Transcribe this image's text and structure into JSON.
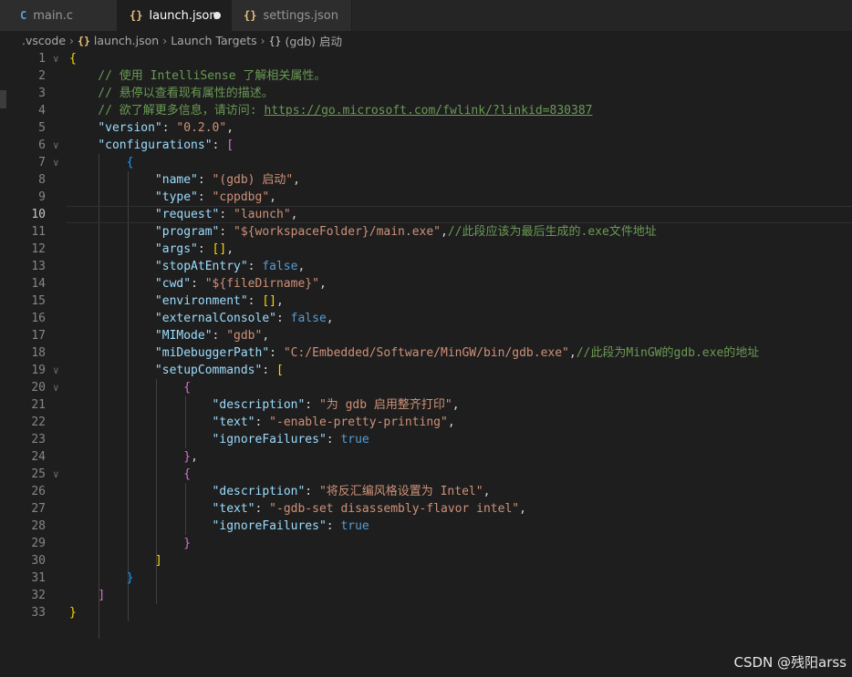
{
  "tabs": [
    {
      "label": "main.c",
      "icon": "C"
    },
    {
      "label": "launch.json",
      "icon": "{}"
    },
    {
      "label": "settings.json",
      "icon": "{}"
    }
  ],
  "breadcrumb": {
    "folder": ".vscode",
    "file": "launch.json",
    "section": "Launch Targets",
    "item": "(gdb) 启动"
  },
  "editor": {
    "active_line": 10,
    "lines": [
      {
        "n": "1",
        "fold": "v",
        "tok": [
          [
            "{",
            "y"
          ]
        ]
      },
      {
        "n": "2",
        "tok": [
          [
            "    // 使用 IntelliSense 了解相关属性。",
            "c"
          ]
        ]
      },
      {
        "n": "3",
        "tok": [
          [
            "    // 悬停以查看现有属性的描述。",
            "c"
          ]
        ]
      },
      {
        "n": "4",
        "tok": [
          [
            "    // 欲了解更多信息，请访问: ",
            "c"
          ],
          [
            "https://go.microsoft.com/fwlink/?linkid=830387",
            "cu"
          ]
        ]
      },
      {
        "n": "5",
        "tok": [
          [
            "    ",
            "p"
          ],
          [
            "\"version\"",
            "k"
          ],
          [
            ": ",
            "p"
          ],
          [
            "\"0.2.0\"",
            "s"
          ],
          [
            ",",
            "p"
          ]
        ]
      },
      {
        "n": "6",
        "fold": "v",
        "tok": [
          [
            "    ",
            "p"
          ],
          [
            "\"configurations\"",
            "k"
          ],
          [
            ": ",
            "p"
          ],
          [
            "[",
            "m"
          ]
        ]
      },
      {
        "n": "7",
        "fold": "v",
        "tok": [
          [
            "        ",
            "p"
          ],
          [
            "{",
            "bl"
          ]
        ]
      },
      {
        "n": "8",
        "tok": [
          [
            "            ",
            "p"
          ],
          [
            "\"name\"",
            "k"
          ],
          [
            ": ",
            "p"
          ],
          [
            "\"(gdb) 启动\"",
            "s"
          ],
          [
            ",",
            "p"
          ]
        ]
      },
      {
        "n": "9",
        "tok": [
          [
            "            ",
            "p"
          ],
          [
            "\"type\"",
            "k"
          ],
          [
            ": ",
            "p"
          ],
          [
            "\"cppdbg\"",
            "s"
          ],
          [
            ",",
            "p"
          ]
        ]
      },
      {
        "n": "10",
        "tok": [
          [
            "            ",
            "p"
          ],
          [
            "\"request\"",
            "k"
          ],
          [
            ": ",
            "p"
          ],
          [
            "\"launch\"",
            "s"
          ],
          [
            ",",
            "p"
          ]
        ]
      },
      {
        "n": "11",
        "tok": [
          [
            "            ",
            "p"
          ],
          [
            "\"program\"",
            "k"
          ],
          [
            ": ",
            "p"
          ],
          [
            "\"${workspaceFolder}/main.exe\"",
            "s"
          ],
          [
            ",",
            "p"
          ],
          [
            "//此段应该为最后生成的.exe文件地址",
            "c"
          ]
        ]
      },
      {
        "n": "12",
        "tok": [
          [
            "            ",
            "p"
          ],
          [
            "\"args\"",
            "k"
          ],
          [
            ": ",
            "p"
          ],
          [
            "[]",
            "y"
          ],
          [
            ",",
            "p"
          ]
        ]
      },
      {
        "n": "13",
        "tok": [
          [
            "            ",
            "p"
          ],
          [
            "\"stopAtEntry\"",
            "k"
          ],
          [
            ": ",
            "p"
          ],
          [
            "false",
            "b"
          ],
          [
            ",",
            "p"
          ]
        ]
      },
      {
        "n": "14",
        "tok": [
          [
            "            ",
            "p"
          ],
          [
            "\"cwd\"",
            "k"
          ],
          [
            ": ",
            "p"
          ],
          [
            "\"${fileDirname}\"",
            "s"
          ],
          [
            ",",
            "p"
          ]
        ]
      },
      {
        "n": "15",
        "tok": [
          [
            "            ",
            "p"
          ],
          [
            "\"environment\"",
            "k"
          ],
          [
            ": ",
            "p"
          ],
          [
            "[]",
            "y"
          ],
          [
            ",",
            "p"
          ]
        ]
      },
      {
        "n": "16",
        "tok": [
          [
            "            ",
            "p"
          ],
          [
            "\"externalConsole\"",
            "k"
          ],
          [
            ": ",
            "p"
          ],
          [
            "false",
            "b"
          ],
          [
            ",",
            "p"
          ]
        ]
      },
      {
        "n": "17",
        "tok": [
          [
            "            ",
            "p"
          ],
          [
            "\"MIMode\"",
            "k"
          ],
          [
            ": ",
            "p"
          ],
          [
            "\"gdb\"",
            "s"
          ],
          [
            ",",
            "p"
          ]
        ]
      },
      {
        "n": "18",
        "tok": [
          [
            "            ",
            "p"
          ],
          [
            "\"miDebuggerPath\"",
            "k"
          ],
          [
            ": ",
            "p"
          ],
          [
            "\"C:/Embedded/Software/MinGW/bin/gdb.exe\"",
            "s"
          ],
          [
            ",",
            "p"
          ],
          [
            "//此段为MinGW的gdb.exe的地址",
            "c"
          ]
        ]
      },
      {
        "n": "19",
        "fold": "v",
        "tok": [
          [
            "            ",
            "p"
          ],
          [
            "\"setupCommands\"",
            "k"
          ],
          [
            ": ",
            "p"
          ],
          [
            "[",
            "y"
          ]
        ]
      },
      {
        "n": "20",
        "fold": "v",
        "tok": [
          [
            "                ",
            "p"
          ],
          [
            "{",
            "m"
          ]
        ]
      },
      {
        "n": "21",
        "tok": [
          [
            "                    ",
            "p"
          ],
          [
            "\"description\"",
            "k"
          ],
          [
            ": ",
            "p"
          ],
          [
            "\"为 gdb 启用整齐打印\"",
            "s"
          ],
          [
            ",",
            "p"
          ]
        ]
      },
      {
        "n": "22",
        "tok": [
          [
            "                    ",
            "p"
          ],
          [
            "\"text\"",
            "k"
          ],
          [
            ": ",
            "p"
          ],
          [
            "\"-enable-pretty-printing\"",
            "s"
          ],
          [
            ",",
            "p"
          ]
        ]
      },
      {
        "n": "23",
        "tok": [
          [
            "                    ",
            "p"
          ],
          [
            "\"ignoreFailures\"",
            "k"
          ],
          [
            ": ",
            "p"
          ],
          [
            "true",
            "b"
          ]
        ]
      },
      {
        "n": "24",
        "tok": [
          [
            "                ",
            "p"
          ],
          [
            "}",
            "m"
          ],
          [
            ",",
            "p"
          ]
        ]
      },
      {
        "n": "25",
        "fold": "v",
        "tok": [
          [
            "                ",
            "p"
          ],
          [
            "{",
            "m"
          ]
        ]
      },
      {
        "n": "26",
        "tok": [
          [
            "                    ",
            "p"
          ],
          [
            "\"description\"",
            "k"
          ],
          [
            ": ",
            "p"
          ],
          [
            "\"将反汇编风格设置为 Intel\"",
            "s"
          ],
          [
            ",",
            "p"
          ]
        ]
      },
      {
        "n": "27",
        "tok": [
          [
            "                    ",
            "p"
          ],
          [
            "\"text\"",
            "k"
          ],
          [
            ": ",
            "p"
          ],
          [
            "\"-gdb-set disassembly-flavor intel\"",
            "s"
          ],
          [
            ",",
            "p"
          ]
        ]
      },
      {
        "n": "28",
        "tok": [
          [
            "                    ",
            "p"
          ],
          [
            "\"ignoreFailures\"",
            "k"
          ],
          [
            ": ",
            "p"
          ],
          [
            "true",
            "b"
          ]
        ]
      },
      {
        "n": "29",
        "tok": [
          [
            "                ",
            "p"
          ],
          [
            "}",
            "m"
          ]
        ]
      },
      {
        "n": "30",
        "tok": [
          [
            "            ",
            "p"
          ],
          [
            "]",
            "y"
          ]
        ]
      },
      {
        "n": "31",
        "tok": [
          [
            "        ",
            "p"
          ],
          [
            "}",
            "bl"
          ]
        ]
      },
      {
        "n": "32",
        "tok": [
          [
            "    ",
            "p"
          ],
          [
            "]",
            "m"
          ]
        ]
      },
      {
        "n": "33",
        "tok": [
          [
            "}",
            "y"
          ]
        ]
      }
    ]
  },
  "watermark": "CSDN @残阳arss"
}
